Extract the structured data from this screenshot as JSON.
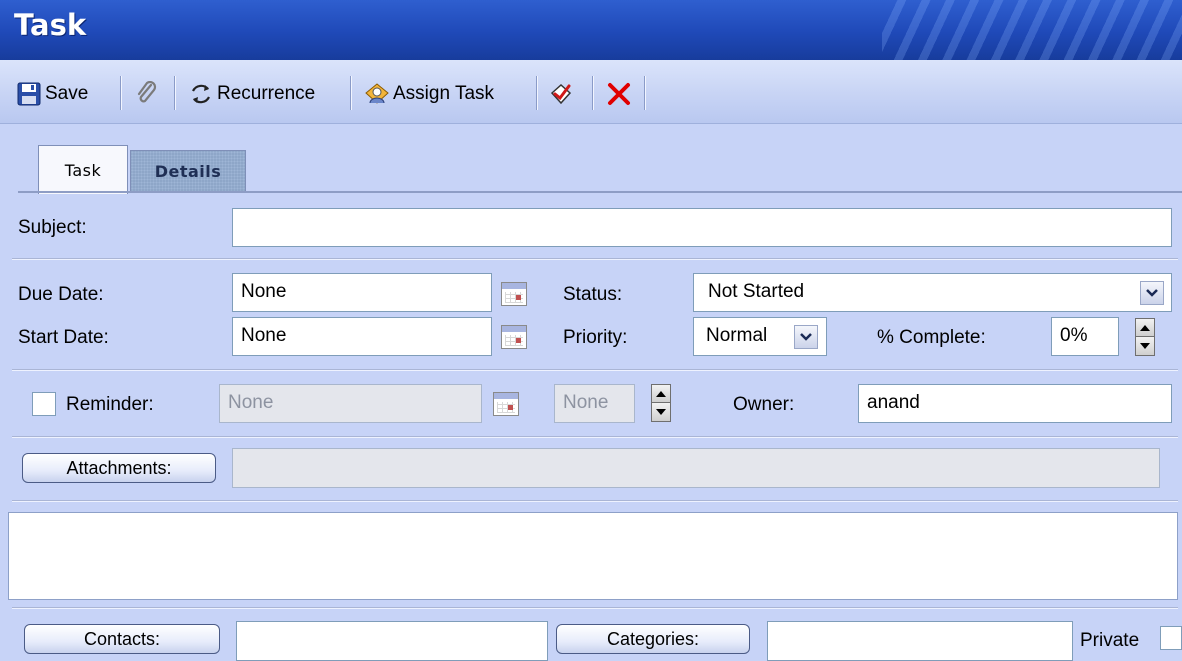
{
  "window": {
    "title": "Task"
  },
  "toolbar": {
    "save_label": "Save",
    "recurrence_label": "Recurrence",
    "assign_task_label": "Assign Task"
  },
  "tabs": [
    {
      "label": "Task",
      "active": true
    },
    {
      "label": "Details",
      "active": false
    }
  ],
  "form": {
    "subject": {
      "label": "Subject:",
      "value": ""
    },
    "due_date": {
      "label": "Due Date:",
      "value": "None"
    },
    "start_date": {
      "label": "Start Date:",
      "value": "None"
    },
    "status": {
      "label": "Status:",
      "value": "Not Started"
    },
    "priority": {
      "label": "Priority:",
      "value": "Normal"
    },
    "percent_complete": {
      "label": "% Complete:",
      "value": "0%"
    },
    "reminder": {
      "label": "Reminder:",
      "date": "None",
      "time": "None",
      "checked": false
    },
    "owner": {
      "label": "Owner:",
      "value": "anand"
    },
    "attachments": {
      "button_label": "Attachments:",
      "value": ""
    },
    "notes": {
      "value": ""
    },
    "contacts": {
      "button_label": "Contacts:",
      "value": ""
    },
    "categories": {
      "button_label": "Categories:",
      "value": ""
    },
    "private": {
      "label": "Private",
      "checked": false
    }
  },
  "colors": {
    "titlebar": "#1f49b8",
    "background": "#c7d3f7",
    "delete_icon": "#e00000"
  },
  "icons": [
    "save-icon",
    "paperclip-icon",
    "recurrence-icon",
    "assign-task-icon",
    "mark-complete-icon",
    "delete-icon",
    "calendar-icon",
    "chevron-down-icon"
  ]
}
